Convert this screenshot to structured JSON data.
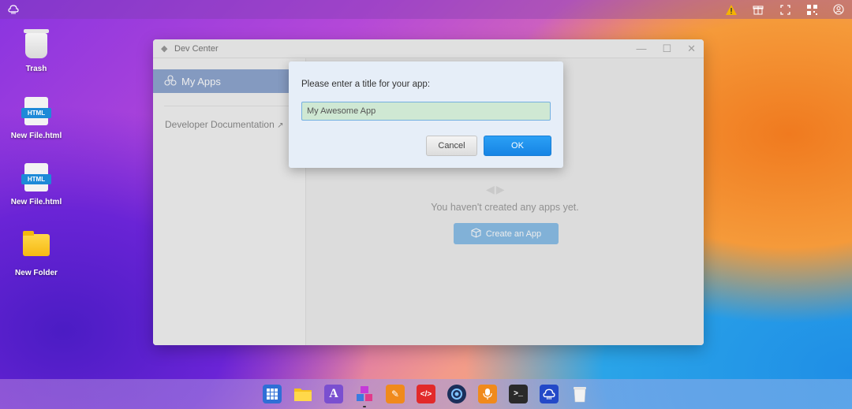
{
  "topbar": {
    "left_icon": "puter-logo-icon",
    "right_icons": [
      "warning-icon",
      "gift-icon",
      "fullscreen-icon",
      "qr-code-icon",
      "user-icon"
    ],
    "colors": {
      "warning": "#f5b400"
    }
  },
  "desktop": {
    "items": [
      {
        "label": "Trash",
        "icon": "trash-icon"
      },
      {
        "label": "New File.html",
        "icon": "html-file-icon",
        "badge": "HTML"
      },
      {
        "label": "New File.html",
        "icon": "html-file-icon",
        "badge": "HTML"
      },
      {
        "label": "New Folder",
        "icon": "folder-icon"
      }
    ]
  },
  "window": {
    "title": "Dev Center",
    "controls": {
      "minimize": "—",
      "maximize": "☐",
      "close": "✕"
    },
    "sidebar": {
      "active_item": "My Apps",
      "doc_link": "Developer Documentation",
      "doc_link_icon": "external-link-icon"
    },
    "main": {
      "empty_message": "You haven't created any apps yet.",
      "create_button": "Create an App"
    }
  },
  "dialog": {
    "prompt": "Please enter a title for your app:",
    "input_value": "My Awesome App",
    "cancel_label": "Cancel",
    "ok_label": "OK",
    "colors": {
      "ok": "#1c8aea",
      "input_bg": "#cfe8d3"
    }
  },
  "dock": {
    "apps": [
      {
        "name": "app-launcher",
        "glyph": "▦",
        "bg": "#2f6fd6"
      },
      {
        "name": "files",
        "glyph": "",
        "bg": "#f6c11c"
      },
      {
        "name": "editor",
        "glyph": "A",
        "bg": "#7a4fd0"
      },
      {
        "name": "dev-center",
        "glyph": "◆",
        "bg": "#c53ad8"
      },
      {
        "name": "paint",
        "glyph": "✎",
        "bg": "#f08a1c"
      },
      {
        "name": "code",
        "glyph": "</>",
        "bg": "#e22a2a"
      },
      {
        "name": "camera",
        "glyph": "◉",
        "bg": "#1b2f5a"
      },
      {
        "name": "recorder",
        "glyph": "●",
        "bg": "#f08a1c"
      },
      {
        "name": "terminal",
        "glyph": ">_",
        "bg": "#2a2a2a"
      },
      {
        "name": "puter",
        "glyph": "☁",
        "bg": "#2349c8"
      },
      {
        "name": "trash",
        "glyph": "",
        "bg": "#e8e8e8"
      }
    ]
  }
}
